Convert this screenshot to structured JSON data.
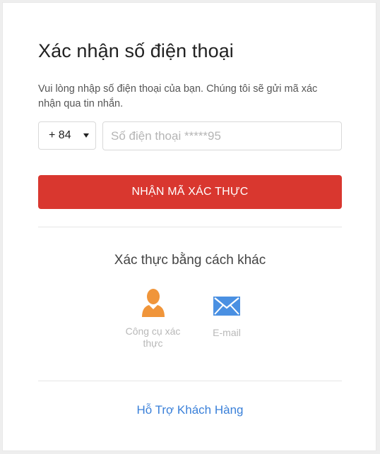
{
  "page": {
    "title": "Xác nhận số điện thoại",
    "description": "Vui lòng nhập số điện thoại của bạn. Chúng tôi sẽ gửi mã xác nhận qua tin nhắn."
  },
  "phone": {
    "country_code": "+ 84",
    "placeholder": "Số điện thoại *****95",
    "value": ""
  },
  "submit": {
    "label": "NHẬN MÃ XÁC THỰC"
  },
  "alternatives": {
    "title": "Xác thực bằng cách khác",
    "methods": [
      {
        "label": "Công cụ xác thực",
        "icon": "user-icon",
        "color": "#f0953a"
      },
      {
        "label": "E-mail",
        "icon": "mail-icon",
        "color": "#4a90e2"
      }
    ]
  },
  "support": {
    "label": "Hỗ Trợ Khách Hàng"
  },
  "colors": {
    "accent": "#d9372f",
    "link": "#3a80d9"
  }
}
